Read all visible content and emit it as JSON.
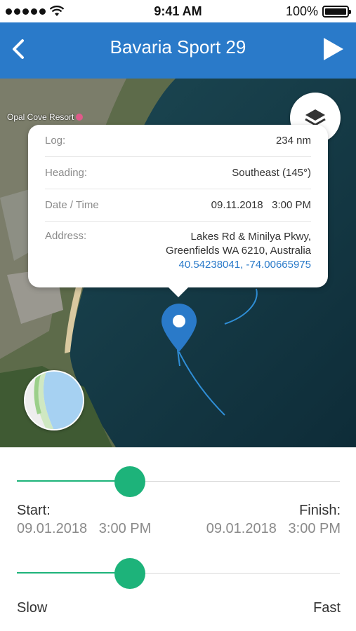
{
  "status_bar": {
    "time": "9:41 AM",
    "battery": "100%",
    "battery_level": 1.0
  },
  "header": {
    "title": "Bavaria Sport 29",
    "back_icon": "chevron-left-icon",
    "play_icon": "play-icon"
  },
  "map": {
    "place_label": "Opal Cove Resort",
    "info": {
      "log_label": "Log:",
      "log_value": "234 nm",
      "heading_label": "Heading:",
      "heading_value": "Southeast (145°)",
      "datetime_label": "Date / Time",
      "datetime_value": "09.11.2018   3:00 PM",
      "address_label": "Address:",
      "address_line1": "Lakes Rd & Minilya Pkwy,",
      "address_line2": "Greenfields WA 6210, Australia",
      "coordinates": "40.54238041, -74.00665975"
    }
  },
  "timeline": {
    "position_fraction": 0.35,
    "start_label": "Start:",
    "start_value": "09.01.2018   3:00 PM",
    "finish_label": "Finish:",
    "finish_value": "09.01.2018   3:00 PM"
  },
  "speed": {
    "position_fraction": 0.35,
    "slow_label": "Slow",
    "fast_label": "Fast"
  },
  "colors": {
    "header": "#2a7ac9",
    "accent": "#1db37a",
    "link": "#2a7ac9"
  }
}
